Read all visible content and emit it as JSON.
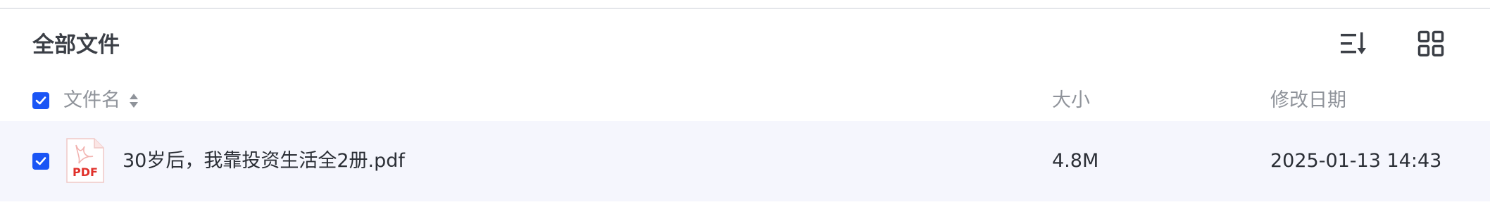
{
  "section": {
    "title": "全部文件"
  },
  "toolbar": {
    "sort_icon": "sort-list-icon",
    "view_icon": "grid-view-icon"
  },
  "table": {
    "columns": {
      "name": "文件名",
      "size": "大小",
      "modified": "修改日期"
    },
    "rows": [
      {
        "selected": true,
        "file_type": "PDF",
        "name": "30岁后，我靠投资生活全2册.pdf",
        "size": "4.8M",
        "modified": "2025-01-13 14:43"
      }
    ]
  },
  "colors": {
    "accent": "#1a55f5",
    "row_highlight": "#f5f6fd",
    "pdf_red": "#e0312b"
  }
}
